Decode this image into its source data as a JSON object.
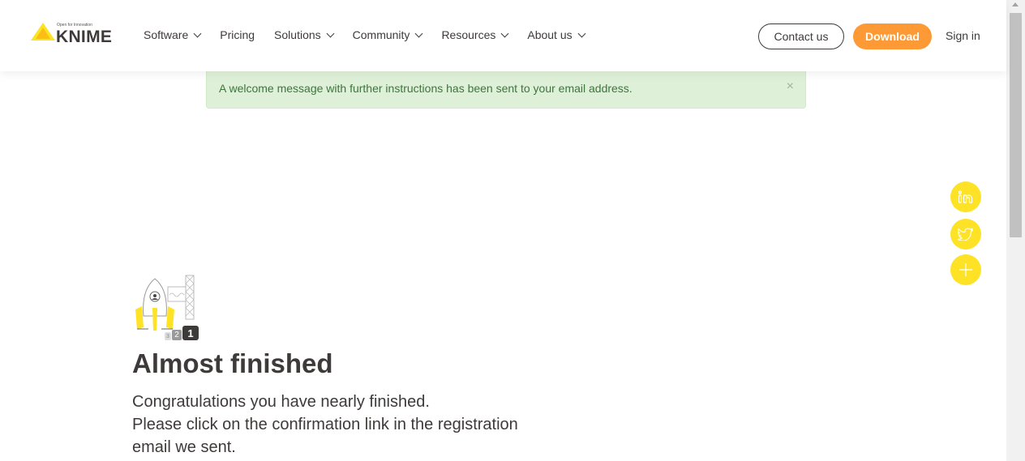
{
  "logo": {
    "tagline": "Open for Innovation",
    "wordmark": "KNIME"
  },
  "nav": {
    "items": [
      {
        "label": "Software",
        "dropdown": true
      },
      {
        "label": "Pricing",
        "dropdown": false
      },
      {
        "label": "Solutions",
        "dropdown": true
      },
      {
        "label": "Community",
        "dropdown": true
      },
      {
        "label": "Resources",
        "dropdown": true
      },
      {
        "label": "About us",
        "dropdown": true
      }
    ],
    "contact_label": "Contact us",
    "download_label": "Download",
    "signin_label": "Sign in"
  },
  "alert": {
    "message": "A welcome message with further instructions has been sent to your email address.",
    "close_symbol": "×"
  },
  "social": [
    {
      "name": "linkedin-icon",
      "symbol": "in"
    },
    {
      "name": "twitter-icon",
      "symbol": "🐦"
    },
    {
      "name": "plus-icon",
      "symbol": "+"
    }
  ],
  "main": {
    "countdown": [
      "3",
      "2",
      "1"
    ],
    "title": "Almost finished",
    "lines": [
      "Congratulations you have nearly finished.",
      "Please click on the confirmation link in the registration",
      "email we sent."
    ]
  },
  "colors": {
    "accent_orange": "#fd9a35",
    "social_yellow": "#fde226",
    "alert_bg": "#dff0d8",
    "alert_text": "#3c763d",
    "text_dark": "#3e3a39"
  }
}
